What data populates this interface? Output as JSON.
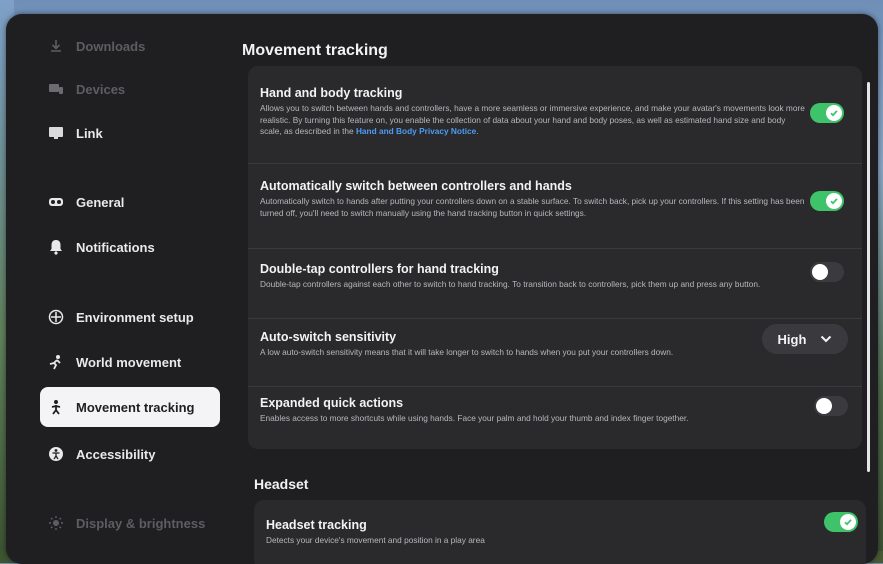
{
  "sidebar": {
    "items": [
      {
        "label": "Downloads",
        "icon": "download-icon"
      },
      {
        "label": "Devices",
        "icon": "devices-icon"
      },
      {
        "label": "Link",
        "icon": "link-icon"
      },
      {
        "label": "General",
        "icon": "headset-icon"
      },
      {
        "label": "Notifications",
        "icon": "bell-icon"
      },
      {
        "label": "Environment setup",
        "icon": "environment-icon"
      },
      {
        "label": "World movement",
        "icon": "world-movement-icon"
      },
      {
        "label": "Movement tracking",
        "icon": "movement-tracking-icon",
        "active": true
      },
      {
        "label": "Accessibility",
        "icon": "accessibility-icon"
      },
      {
        "label": "Display & brightness",
        "icon": "sun-icon"
      }
    ]
  },
  "movement_tracking": {
    "title": "Movement tracking",
    "hand_body": {
      "title": "Hand and body tracking",
      "desc": "Allows you to switch between hands and controllers, have a more seamless or immersive experience, and make your avatar's movements look more realistic. By turning this feature on, you enable the collection of data about your hand and body poses, as well as estimated hand size and body scale, as described in the ",
      "link": "Hand and Body Privacy Notice",
      "desc_end": ".",
      "enabled": true
    },
    "auto_switch": {
      "title": "Automatically switch between controllers and hands",
      "desc": "Automatically switch to hands after putting your controllers down on a stable surface. To switch back, pick up your controllers. If this setting has been turned off, you'll need to switch manually using the hand tracking button in quick settings.",
      "enabled": true
    },
    "double_tap": {
      "title": "Double-tap controllers for hand tracking",
      "desc": "Double-tap controllers against each other to switch to hand tracking. To transition back to controllers, pick them up and press any button.",
      "enabled": false
    },
    "sensitivity": {
      "title": "Auto-switch sensitivity",
      "desc": "A low auto-switch sensitivity means that it will take longer to switch to hands when you put your controllers down.",
      "value": "High"
    },
    "quick_actions": {
      "title": "Expanded quick actions",
      "desc": "Enables access to more shortcuts while using hands. Face your palm and hold your thumb and index finger together.",
      "enabled": false
    }
  },
  "headset": {
    "title": "Headset",
    "tracking": {
      "title": "Headset tracking",
      "desc": "Detects your device's movement and position in a play area",
      "enabled": true
    }
  },
  "colors": {
    "toggle_on": "#3ec36a",
    "link": "#4d9cf2",
    "panel": "#1f1f21"
  }
}
